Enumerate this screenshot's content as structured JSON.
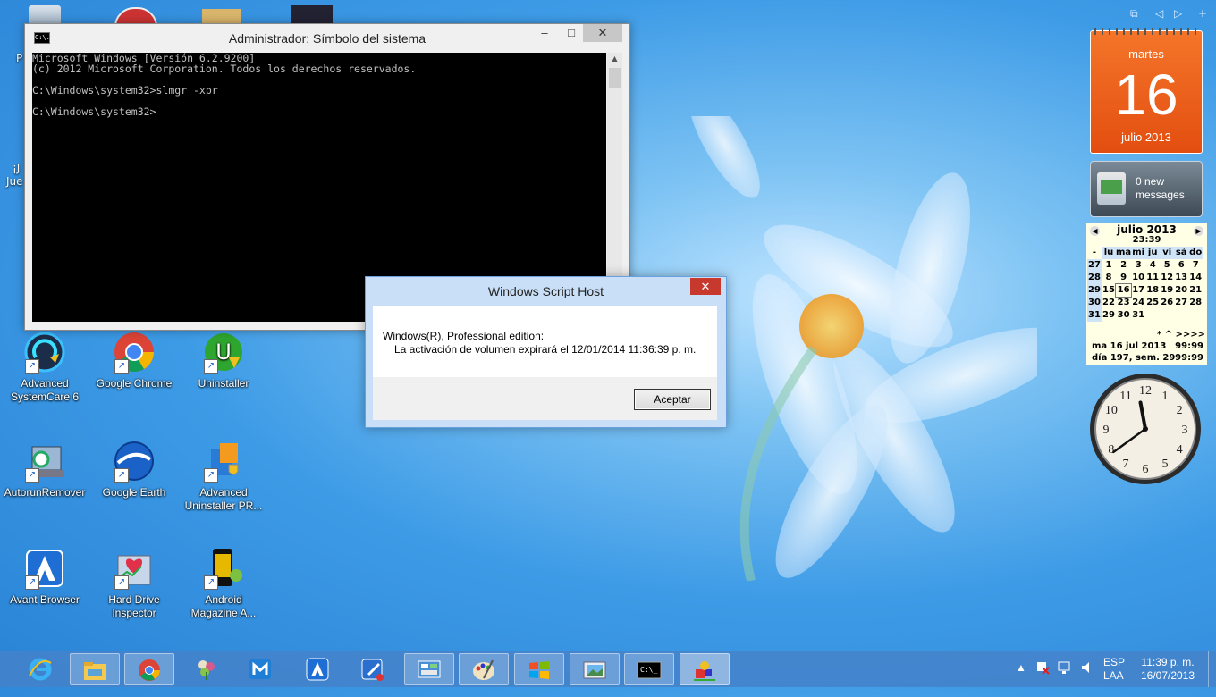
{
  "desktop": {
    "icons": [
      {
        "label": "Advanced SystemCare 6",
        "icon": "systemcare-icon"
      },
      {
        "label": "Google Chrome",
        "icon": "chrome-icon"
      },
      {
        "label": "Uninstaller",
        "icon": "uninstaller-icon"
      },
      {
        "label": "AutorunRemover",
        "icon": "autorunremover-icon"
      },
      {
        "label": "Google Earth",
        "icon": "google-earth-icon"
      },
      {
        "label": "Advanced Uninstaller PR...",
        "icon": "advanced-uninstaller-icon"
      },
      {
        "label": "Avant Browser",
        "icon": "avant-browser-icon"
      },
      {
        "label": "Hard Drive Inspector",
        "icon": "hdd-inspector-icon"
      },
      {
        "label": "Android Magazine A...",
        "icon": "android-magazine-icon"
      }
    ],
    "partial_labels": [
      "P",
      "¡J",
      "Jue"
    ]
  },
  "cmd": {
    "title": "Administrador: Símbolo del sistema",
    "icon_text": "C:\\.",
    "lines": [
      "Microsoft Windows [Versión 6.2.9200]",
      "(c) 2012 Microsoft Corporation. Todos los derechos reservados.",
      "",
      "C:\\Windows\\system32>slmgr -xpr",
      "",
      "C:\\Windows\\system32>"
    ],
    "minimize": "–",
    "maximize": "□",
    "close": "✕"
  },
  "dialog": {
    "title": "Windows Script Host",
    "line1": "Windows(R), Professional edition:",
    "line2": "La activación de volumen expirará el 12/01/2014 11:36:39 p. m.",
    "ok": "Aceptar",
    "close": "✕"
  },
  "gadgets": {
    "controls": [
      "⧉",
      "◁",
      "▷",
      "+"
    ],
    "calendar": {
      "weekday": "martes",
      "day": "16",
      "month": "julio 2013"
    },
    "mail": {
      "line1": "0 new",
      "line2": "messages"
    },
    "minical": {
      "header": "julio 2013",
      "time": "23:39",
      "weekdays": [
        "-",
        "lu",
        "ma",
        "mi",
        "ju",
        "vi",
        "sá",
        "do"
      ],
      "weeks": [
        [
          "27",
          "1",
          "2",
          "3",
          "4",
          "5",
          "6",
          "7"
        ],
        [
          "28",
          "8",
          "9",
          "10",
          "11",
          "12",
          "13",
          "14"
        ],
        [
          "29",
          "15",
          "16",
          "17",
          "18",
          "19",
          "20",
          "21"
        ],
        [
          "30",
          "22",
          "23",
          "24",
          "25",
          "26",
          "27",
          "28"
        ],
        [
          "31",
          "29",
          "30",
          "31",
          "",
          "",
          "",
          ""
        ]
      ],
      "nav_line": "*   ^  >>>>",
      "info_date": "ma 16 jul 2013",
      "info_val1": "99:99",
      "info_day": "día 197, sem. 29",
      "info_val2": "99:99"
    },
    "clock": {
      "hour": 11,
      "minute": 39
    }
  },
  "taskbar": {
    "apps": [
      {
        "name": "internet-explorer-icon",
        "pinned": false
      },
      {
        "name": "file-explorer-icon",
        "pinned": true
      },
      {
        "name": "chrome-icon",
        "pinned": true
      },
      {
        "name": "flower-app-icon",
        "pinned": false
      },
      {
        "name": "maxthon-icon",
        "pinned": false
      },
      {
        "name": "avant-browser-icon",
        "pinned": false
      },
      {
        "name": "pen-tool-icon",
        "pinned": false
      },
      {
        "name": "control-panel-icon",
        "pinned": true
      },
      {
        "name": "paint-icon",
        "pinned": true
      },
      {
        "name": "windows-flag-icon",
        "pinned": true
      },
      {
        "name": "photo-viewer-icon",
        "pinned": true
      },
      {
        "name": "cmd-icon",
        "pinned": true
      },
      {
        "name": "script-host-icon",
        "pinned": true
      }
    ],
    "lang1": "ESP",
    "lang2": "LAA",
    "time": "11:39 p. m.",
    "date": "16/07/2013"
  }
}
